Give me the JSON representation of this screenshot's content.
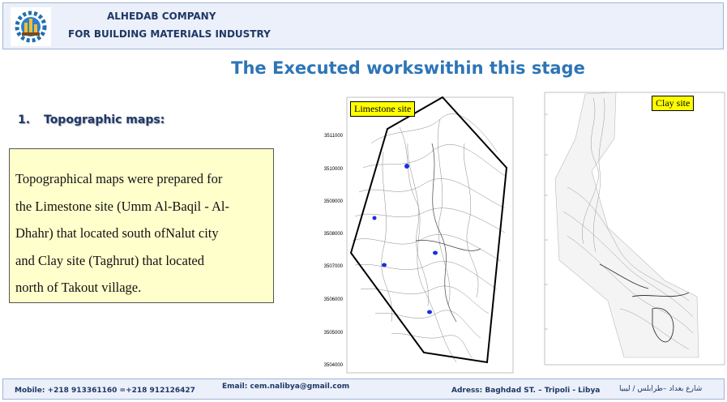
{
  "header": {
    "company_line1": "ALHEDAB COMPANY",
    "company_line2": "FOR BUILDING MATERIALS INDUSTRY",
    "logo_icon": "gear-factory-logo"
  },
  "title": "The Executed workswithin this stage",
  "section": {
    "number": "1.",
    "label": "Topographic maps:"
  },
  "body_lines": [
    "Topographical maps were prepared for",
    "the Limestone site (Umm Al-Baqil - Al-",
    "Dhahr) that located south ofNalut city",
    "and Clay site (Taghrut) that located",
    "north of Takout  village."
  ],
  "limestone_map": {
    "label": "Limestone site",
    "y_ticks": [
      "3511000",
      "3510000",
      "3509000",
      "3508000",
      "3507000",
      "3506000",
      "3505000",
      "3504000"
    ]
  },
  "clay_map": {
    "label": "Clay site"
  },
  "footer": {
    "mobile": "Mobile: +218 913361160 =+218 912126427",
    "email": "Email: cem.nalibya@gmail.com",
    "address": "Adress: Baghdad ST. – Tripoli - Libya",
    "address_arabic": "شارع بغداد –طرابلس / ليبيا"
  },
  "colors": {
    "header_bg": "#ebf0fa",
    "title": "#2e75b6",
    "dark_blue": "#1f3864",
    "textbox_bg": "#ffffcc",
    "label_bg": "#ffff00"
  }
}
